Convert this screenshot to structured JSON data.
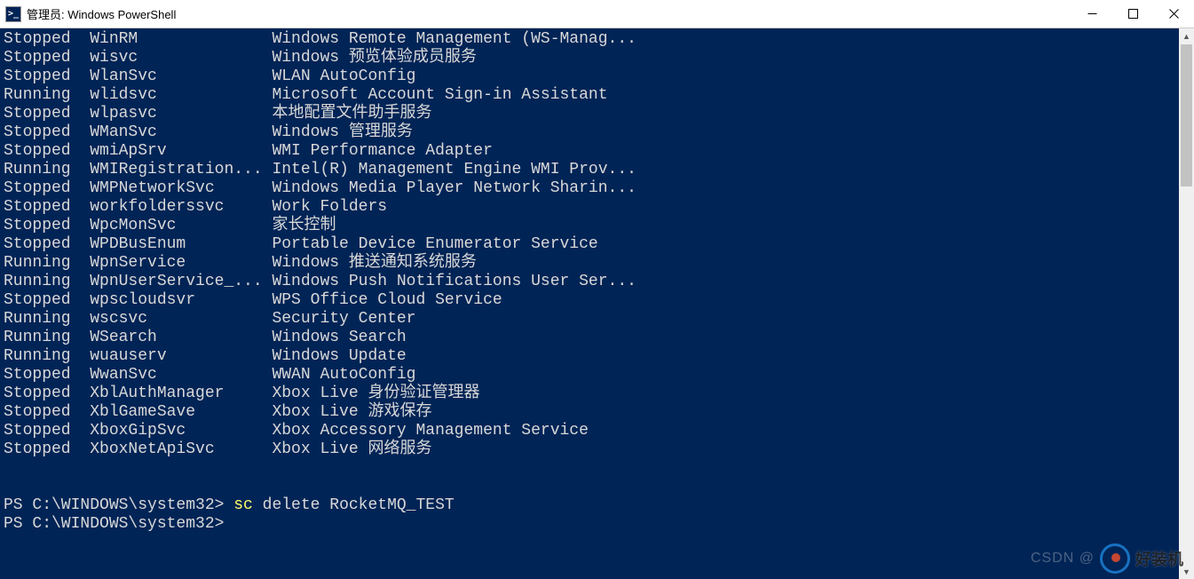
{
  "window": {
    "title": "管理员: Windows PowerShell",
    "icon_label": ">_"
  },
  "services": [
    {
      "status": "Stopped",
      "name": "WinRM",
      "display": "Windows Remote Management (WS-Manag..."
    },
    {
      "status": "Stopped",
      "name": "wisvc",
      "display": "Windows 预览体验成员服务"
    },
    {
      "status": "Stopped",
      "name": "WlanSvc",
      "display": "WLAN AutoConfig"
    },
    {
      "status": "Running",
      "name": "wlidsvc",
      "display": "Microsoft Account Sign-in Assistant"
    },
    {
      "status": "Stopped",
      "name": "wlpasvc",
      "display": "本地配置文件助手服务"
    },
    {
      "status": "Stopped",
      "name": "WManSvc",
      "display": "Windows 管理服务"
    },
    {
      "status": "Stopped",
      "name": "wmiApSrv",
      "display": "WMI Performance Adapter"
    },
    {
      "status": "Running",
      "name": "WMIRegistration...",
      "display": "Intel(R) Management Engine WMI Prov..."
    },
    {
      "status": "Stopped",
      "name": "WMPNetworkSvc",
      "display": "Windows Media Player Network Sharin..."
    },
    {
      "status": "Stopped",
      "name": "workfolderssvc",
      "display": "Work Folders"
    },
    {
      "status": "Stopped",
      "name": "WpcMonSvc",
      "display": "家长控制"
    },
    {
      "status": "Stopped",
      "name": "WPDBusEnum",
      "display": "Portable Device Enumerator Service"
    },
    {
      "status": "Running",
      "name": "WpnService",
      "display": "Windows 推送通知系统服务"
    },
    {
      "status": "Running",
      "name": "WpnUserService_...",
      "display": "Windows Push Notifications User Ser..."
    },
    {
      "status": "Stopped",
      "name": "wpscloudsvr",
      "display": "WPS Office Cloud Service"
    },
    {
      "status": "Running",
      "name": "wscsvc",
      "display": "Security Center"
    },
    {
      "status": "Running",
      "name": "WSearch",
      "display": "Windows Search"
    },
    {
      "status": "Running",
      "name": "wuauserv",
      "display": "Windows Update"
    },
    {
      "status": "Stopped",
      "name": "WwanSvc",
      "display": "WWAN AutoConfig"
    },
    {
      "status": "Stopped",
      "name": "XblAuthManager",
      "display": "Xbox Live 身份验证管理器"
    },
    {
      "status": "Stopped",
      "name": "XblGameSave",
      "display": "Xbox Live 游戏保存"
    },
    {
      "status": "Stopped",
      "name": "XboxGipSvc",
      "display": "Xbox Accessory Management Service"
    },
    {
      "status": "Stopped",
      "name": "XboxNetApiSvc",
      "display": "Xbox Live 网络服务"
    }
  ],
  "columns": {
    "status_w": 9,
    "name_w": 19
  },
  "prompt1": {
    "prefix": "PS C:\\WINDOWS\\system32> ",
    "cmd": "sc ",
    "args": "delete RocketMQ_TEST"
  },
  "prompt2": {
    "prefix": "PS C:\\WINDOWS\\system32> "
  },
  "watermark": {
    "csdn": "CSDN @",
    "brand": "好装机"
  }
}
